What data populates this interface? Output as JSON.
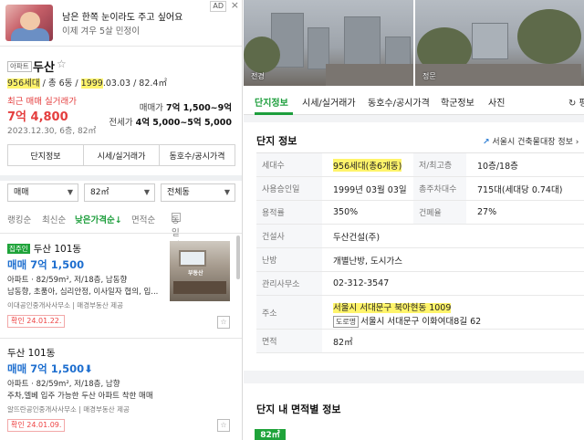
{
  "ad": {
    "title": "남은 한쪽 눈이라도 주고 싶어요",
    "subtitle": "이제 겨우 5살 민정이",
    "badge": "AD",
    "close": "×"
  },
  "property": {
    "type_badge": "아파트",
    "name": "두산",
    "star": "☆",
    "households_hl": "956세대",
    "meta_mid": " / 총 6동 / ",
    "year_hl": "1999",
    "meta_tail": ".03.03 / 82.4㎡",
    "recent_label": "최근 매매 실거래가",
    "recent_price": "7억 4,800",
    "recent_date": "2023.12.30, 6층, 82㎡",
    "sale_label": "매매가",
    "sale_value": "7억 1,500~9억",
    "jeonse_label": "전세가",
    "jeonse_value": "4억 5,000~5억 5,000"
  },
  "left_tabs": [
    "단지정보",
    "시세/실거래가",
    "동호수/공시가격"
  ],
  "filters": {
    "trade": "매매",
    "area": "82㎡",
    "dong": "전체동"
  },
  "sort": {
    "ranking": "랭킹순",
    "latest": "최신순",
    "lowest": "낮은가격순↓",
    "area": "면적순",
    "same_listing": "동일매물 묶기"
  },
  "listings": [
    {
      "badge": "집주인",
      "name": "두산 101동",
      "price": "매매 7억 1,500",
      "detail1": "아파트 · 82/59m², 저/18층, 남동향",
      "detail2": "남동향, 초품아, 심리안정, 이사일자 협의, 입...",
      "agent": "이대공인중개사사무소 | 매경부동산 제공",
      "confirm": "확인 24.01.22.",
      "photo_wm": "부동산"
    },
    {
      "name": "두산 101동",
      "price": "매매 7억 1,500",
      "arrow": "⬇",
      "detail1": "아파트 · 82/59m², 저/18층, 남향",
      "detail2": "주차,엘베 입주 가능한 두산 아파트 착한 매매",
      "agent": "알뜨란공인중개사사무소 | 매경부동산 제공",
      "confirm": "확인 24.01.09."
    }
  ],
  "photo": {
    "label_left": "전경",
    "label_right": "정문"
  },
  "right_tabs": {
    "t1": "단지정보",
    "t2": "시세/실거래가",
    "t3": "동호수/공시가격",
    "t4": "학군정보",
    "t5": "사진",
    "refresh": "↻ 평"
  },
  "complex": {
    "title": "단지 정보",
    "link": "서울시 건축물대장 정보 ›",
    "rows": {
      "households_k": "세대수",
      "households_v": "956세대(총6개동)",
      "floors_k": "저/최고층",
      "floors_v": "10층/18층",
      "approval_k": "사용승인일",
      "approval_v": "1999년 03월 03일",
      "parking_k": "총주차대수",
      "parking_v": "715대(세대당 0.74대)",
      "far_k": "용적률",
      "far_v": "350%",
      "bcr_k": "건폐율",
      "bcr_v": "27%",
      "builder_k": "건설사",
      "builder_v": "두산건설(주)",
      "heating_k": "난방",
      "heating_v": "개별난방, 도시가스",
      "office_k": "관리사무소",
      "office_v": "02-312-3547",
      "address_k": "주소",
      "address_lot": "서울시 서대문구 북아현동 1009",
      "road_badge": "도로명",
      "address_road": "서울시 서대문구 이화여대8길 62",
      "area_k": "면적",
      "area_v": "82㎡"
    }
  },
  "area_info": {
    "title": "단지 내 면적별 정보",
    "chip": "82㎡"
  },
  "colors": {
    "accent_green": "#1d9e3c",
    "price_blue": "#1f6fcf",
    "recent_red": "#e43e3e",
    "highlight": "#fff46b"
  }
}
